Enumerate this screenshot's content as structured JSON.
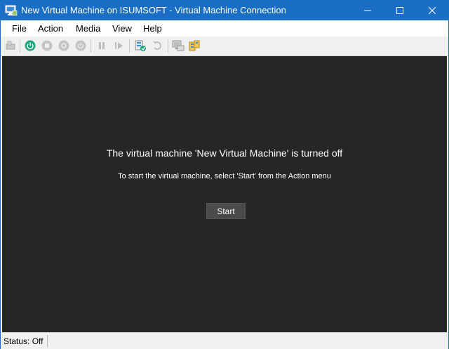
{
  "window": {
    "title": "New Virtual Machine on ISUMSOFT - Virtual Machine Connection",
    "accent_color": "#1a6fc4",
    "controls": [
      "minimize-icon",
      "maximize-icon",
      "close-icon"
    ]
  },
  "menu": {
    "file": "File",
    "action": "Action",
    "media": "Media",
    "view": "View",
    "help": "Help"
  },
  "toolbar": {
    "buttons": [
      "ctrl-alt-del-icon",
      "start-icon",
      "turn-off-icon",
      "shut-down-icon",
      "save-icon",
      "pause-icon",
      "resume-icon",
      "checkpoint-icon",
      "revert-icon",
      "enhanced-session-icon",
      "share-icon"
    ]
  },
  "display": {
    "background": "#262626",
    "message_title": "The virtual machine 'New Virtual Machine' is turned off",
    "message_sub": "To start the virtual machine, select 'Start' from the Action menu",
    "start_label": "Start"
  },
  "status": {
    "text": "Status: Off"
  }
}
